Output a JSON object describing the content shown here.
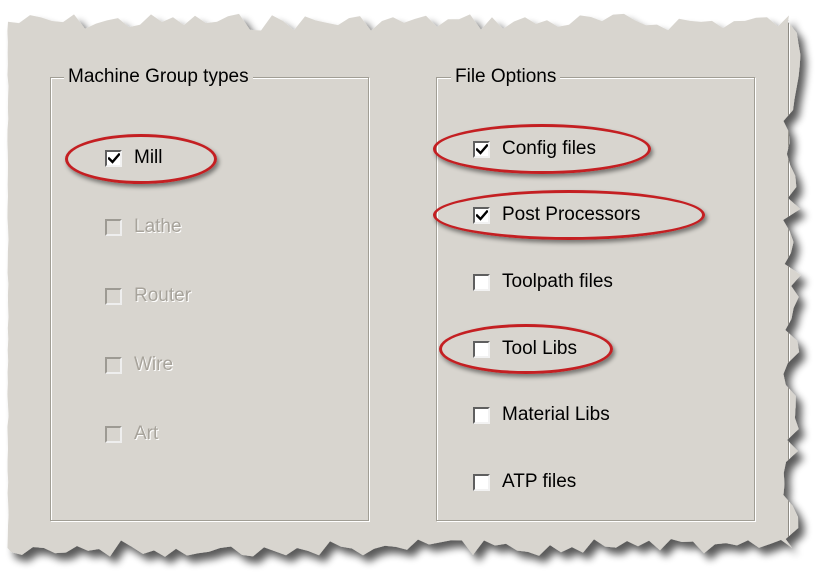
{
  "colors": {
    "dialog_bg": "#d8d5cf",
    "highlight": "#c41f22",
    "disabled_text": "#a7a39b"
  },
  "machine_group": {
    "title": "Machine Group types",
    "items": [
      {
        "label": "Mill",
        "checked": true,
        "enabled": true,
        "highlighted": true
      },
      {
        "label": "Lathe",
        "checked": false,
        "enabled": false,
        "highlighted": false
      },
      {
        "label": "Router",
        "checked": false,
        "enabled": false,
        "highlighted": false
      },
      {
        "label": "Wire",
        "checked": false,
        "enabled": false,
        "highlighted": false
      },
      {
        "label": "Art",
        "checked": false,
        "enabled": false,
        "highlighted": false
      }
    ]
  },
  "file_options": {
    "title": "File Options",
    "items": [
      {
        "label": "Config files",
        "checked": true,
        "enabled": true,
        "highlighted": true
      },
      {
        "label": "Post Processors",
        "checked": true,
        "enabled": true,
        "highlighted": true
      },
      {
        "label": "Toolpath files",
        "checked": false,
        "enabled": true,
        "highlighted": false
      },
      {
        "label": "Tool Libs",
        "checked": false,
        "enabled": true,
        "highlighted": true
      },
      {
        "label": "Material Libs",
        "checked": false,
        "enabled": true,
        "highlighted": false
      },
      {
        "label": "ATP files",
        "checked": false,
        "enabled": true,
        "highlighted": false
      }
    ]
  }
}
